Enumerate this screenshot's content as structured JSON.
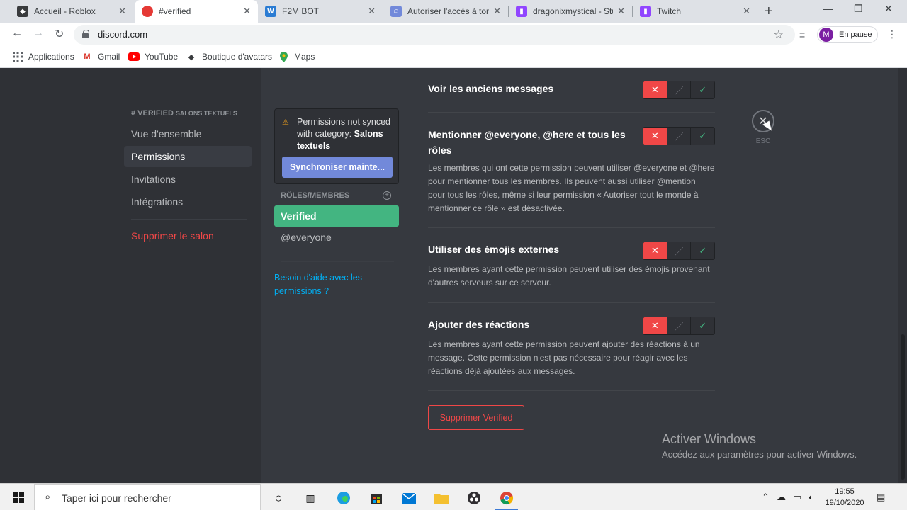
{
  "browser": {
    "tabs": [
      {
        "title": "Accueil - Roblox",
        "icon": "roblox-icon",
        "color": "#393b3d"
      },
      {
        "title": "#verified",
        "icon": "discord-notif-icon",
        "color": "#e53935",
        "active": true
      },
      {
        "title": "F2M BOT",
        "icon": "word-icon",
        "color": "#2b7cd3"
      },
      {
        "title": "Autoriser l'accès à ton",
        "icon": "discord-icon",
        "color": "#7289da"
      },
      {
        "title": "dragonixmystical - Stud",
        "icon": "twitch-icon",
        "color": "#9146ff"
      },
      {
        "title": "Twitch",
        "icon": "twitch-icon",
        "color": "#9146ff"
      }
    ],
    "url": "discord.com",
    "profile_initial": "M",
    "profile_label": "En pause",
    "bookmarks": [
      {
        "label": "Applications",
        "icon": "apps-grid-icon"
      },
      {
        "label": "Gmail",
        "icon": "gmail-icon"
      },
      {
        "label": "YouTube",
        "icon": "youtube-icon"
      },
      {
        "label": "Boutique d'avatars",
        "icon": "roblox-icon"
      },
      {
        "label": "Maps",
        "icon": "maps-pin-icon"
      }
    ]
  },
  "settings": {
    "channel_name": "# VERIFIED",
    "channel_category": "SALONS TEXTUELS",
    "nav": {
      "overview": "Vue d'ensemble",
      "permissions": "Permissions",
      "invites": "Invitations",
      "integrations": "Intégrations",
      "delete_channel": "Supprimer le salon"
    },
    "sync": {
      "text": "Permissions not synced with category: ",
      "category": "Salons textuels",
      "button": "Synchroniser mainte..."
    },
    "roles_header": "RÔLES/MEMBRES",
    "roles": [
      "Verified",
      "@everyone"
    ],
    "help_link": "Besoin d'aide avec les permissions ?",
    "permissions": [
      {
        "title": "Voir les anciens messages",
        "desc": ""
      },
      {
        "title": "Mentionner @everyone, @here et tous les rôles",
        "desc": "Les membres qui ont cette permission peuvent utiliser @everyone et @here pour mentionner tous les membres. Ils peuvent aussi utiliser @mention pour tous les rôles, même si leur permission « Autoriser tout le monde à mentionner ce rôle » est désactivée."
      },
      {
        "title": "Utiliser des émojis externes",
        "desc": "Les membres ayant cette permission peuvent utiliser des émojis provenant d'autres serveurs sur ce serveur."
      },
      {
        "title": "Ajouter des réactions",
        "desc": "Les membres ayant cette permission peuvent ajouter des réactions à un message. Cette permission n'est pas nécessaire pour réagir avec les réactions déjà ajoutées aux messages."
      }
    ],
    "delete_role": "Supprimer Verified",
    "esc_label": "ESC",
    "colors": {
      "deny": "#f04747",
      "allow": "#43b581",
      "blurple": "#7289da",
      "role_active": "#43b581"
    }
  },
  "watermark": {
    "title": "Activer Windows",
    "sub": "Accédez aux paramètres pour activer Windows."
  },
  "taskbar": {
    "search_placeholder": "Taper ici pour rechercher",
    "time": "19:55",
    "date": "19/10/2020"
  }
}
